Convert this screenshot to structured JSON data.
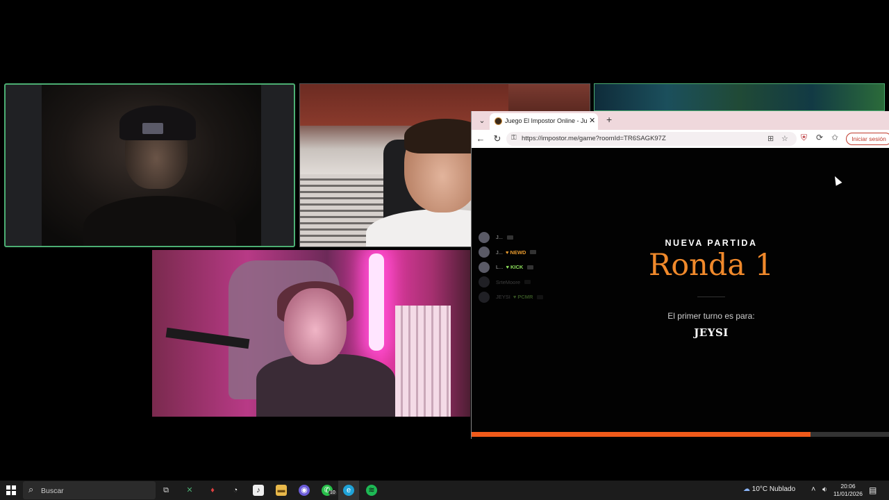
{
  "browser": {
    "tab_title": "Juego El Impostor Online - Jugar g",
    "tab_close": "✕",
    "new_tab": "+",
    "url": "https://impostor.me/game?roomId=TR6SAGK97Z",
    "signin_label": "Iniciar sesión"
  },
  "game": {
    "subtitle": "NUEVA PARTIDA",
    "round_title": "Ronda 1",
    "turn_label": "El primer turno es para:",
    "turn_player": "JEYSI",
    "progress_fraction": 0.81,
    "accent_color": "#f0892b",
    "progress_color": "#f05a1a",
    "players": [
      {
        "name": "J...",
        "badge": "",
        "badge_color": "",
        "dimmed": false
      },
      {
        "name": "J...",
        "badge": "NEWD",
        "badge_color": "#e89a2e",
        "dimmed": false
      },
      {
        "name": "L...",
        "badge": "KICK",
        "badge_color": "#8ee05c",
        "dimmed": false
      },
      {
        "name": "SrteMoore",
        "badge": "",
        "badge_color": "",
        "dimmed": true
      },
      {
        "name": "JEYSI",
        "badge": "PCMR",
        "badge_color": "#8ee05c",
        "dimmed": true
      }
    ]
  },
  "taskbar": {
    "search_placeholder": "Buscar",
    "whatsapp_count": "10",
    "weather_text": "10°C  Nublado",
    "time": "20:06",
    "date": "11/01/2026"
  }
}
